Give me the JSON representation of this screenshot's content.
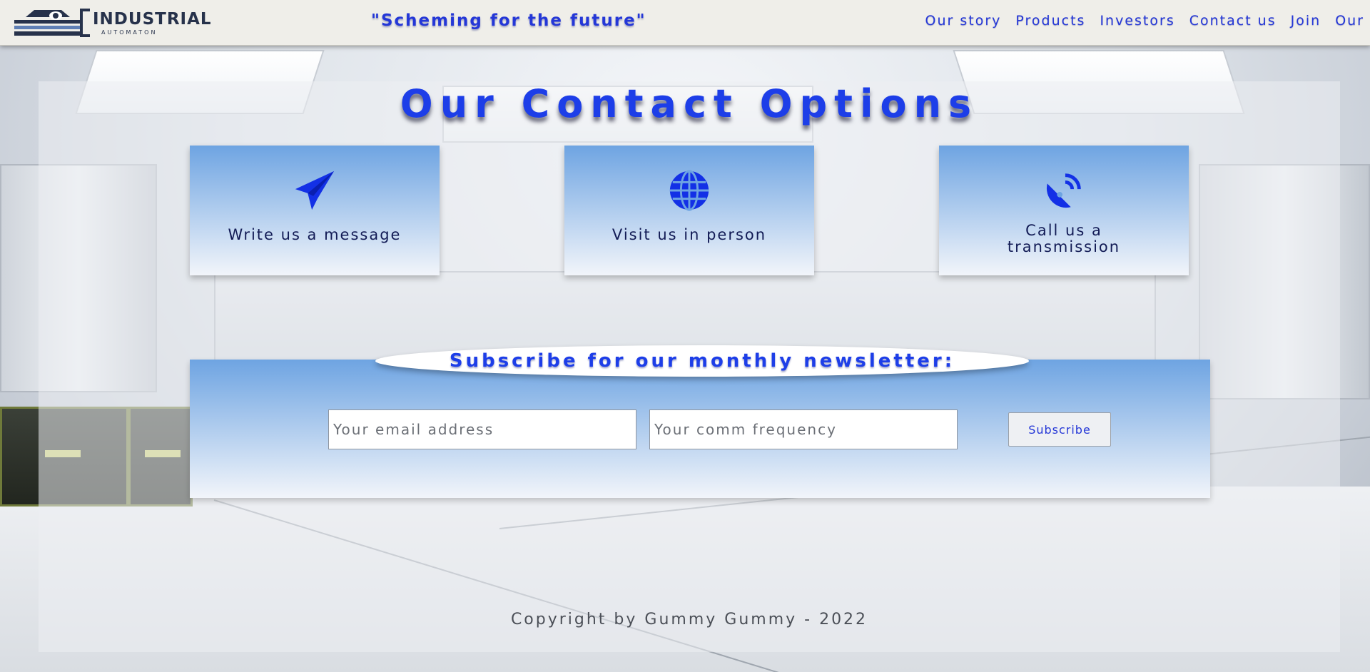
{
  "header": {
    "logo_text": "INDUSTRIAL",
    "logo_sub": "AUTOMATON",
    "announcement": "\"Scheming for the future\"",
    "nav": [
      {
        "label": "Our story"
      },
      {
        "label": "Products"
      },
      {
        "label": "Investors"
      },
      {
        "label": "Contact us"
      },
      {
        "label": "Join"
      },
      {
        "label": "Our"
      }
    ]
  },
  "main": {
    "title": "Our Contact Options",
    "cards": [
      {
        "icon": "paper-plane-icon",
        "label": "Write us a message"
      },
      {
        "icon": "globe-icon",
        "label": "Visit us in person"
      },
      {
        "icon": "satellite-dish-icon",
        "label": "Call us a transmission"
      }
    ],
    "subscribe": {
      "heading": "Subscribe for our monthly newsletter:",
      "email_placeholder": "Your email address",
      "code_placeholder": "Your comm frequency",
      "button_label": "Subscribe"
    },
    "footer": "Copyright by Gummy Gummy - 2022"
  },
  "colors": {
    "accent_blue": "#1d3ee8",
    "card_gradient_top": "#6ea4e2",
    "header_bg": "#efeee9"
  }
}
